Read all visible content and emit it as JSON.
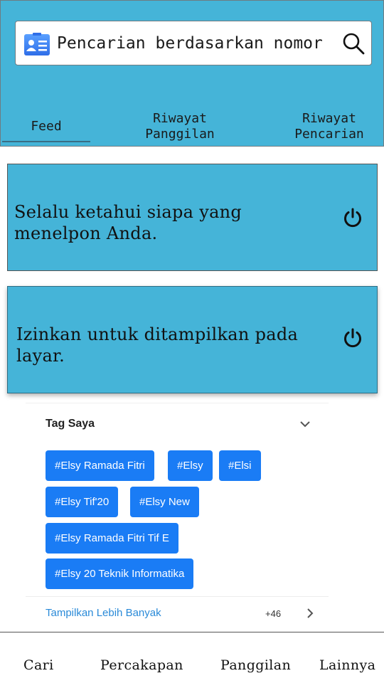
{
  "search": {
    "placeholder": "Pencarian berdasarkan nomor",
    "left_icon": "contact-card-icon",
    "right_icon": "search-icon"
  },
  "tabs": [
    {
      "label_line1": "Feed",
      "label_line2": "",
      "active": true
    },
    {
      "label_line1": "Riwayat",
      "label_line2": "Panggilan",
      "active": false
    },
    {
      "label_line1": "Riwayat",
      "label_line2": "Pencarian",
      "active": false
    }
  ],
  "cards": [
    {
      "text": "Selalu ketahui siapa yang menelpon Anda.",
      "icon": "power-icon"
    },
    {
      "text": "Izinkan untuk ditampilkan pada layar.",
      "icon": "power-icon"
    }
  ],
  "tags": {
    "title": "Tag Saya",
    "items": [
      "#Elsy Ramada Fitri",
      "#Elsy",
      "#Elsi",
      "#Elsy Tif'20",
      "#Elsy New",
      "#Elsy Ramada Fitri Tif E",
      "#Elsy 20 Teknik Informatika"
    ],
    "show_more": "Tampilkan Lebih Banyak",
    "more_count": "+46"
  },
  "bottom_nav": [
    "Cari",
    "Percakapan",
    "Panggilan",
    "Lainnya"
  ],
  "colors": {
    "header_bg": "#45b4d8",
    "card_bg": "#45b4d8",
    "chip_bg": "#1a7cf5",
    "link": "#2a8ad8"
  }
}
